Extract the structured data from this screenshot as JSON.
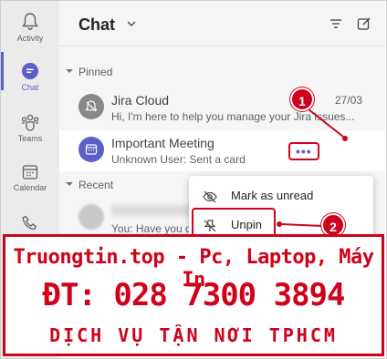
{
  "rail": {
    "items": [
      {
        "label": "Activity",
        "icon": "bell-icon"
      },
      {
        "label": "Chat",
        "icon": "chat-icon"
      },
      {
        "label": "Teams",
        "icon": "teams-icon"
      },
      {
        "label": "Calendar",
        "icon": "calendar-icon"
      },
      {
        "label": "Calls",
        "icon": "phone-icon"
      }
    ],
    "active_color": "#5b5fc7"
  },
  "header": {
    "title": "Chat"
  },
  "sections": {
    "pinned": "Pinned",
    "recent": "Recent"
  },
  "chats": [
    {
      "name": "Jira Cloud",
      "preview": "Hi, I'm here to help you manage your Jira issues...",
      "time": "27/03"
    },
    {
      "name": "Important Meeting",
      "preview": "Unknown User: Sent a card",
      "time": ""
    },
    {
      "name": "",
      "preview": "You: Have you d",
      "time": ""
    }
  ],
  "more_button": {
    "label": "•••"
  },
  "menu": {
    "items": [
      {
        "label": "Mark as unread",
        "icon": "mark-unread-icon"
      },
      {
        "label": "Unpin",
        "icon": "unpin-icon"
      }
    ]
  },
  "callouts": [
    "1",
    "2"
  ],
  "banner": {
    "line1": "Truongtin.top - Pc, Laptop, Máy In",
    "line2": "ĐT: 028 7300 3894",
    "line3": "DỊCH VỤ TẬN NƠI TPHCM"
  },
  "colors": {
    "accent": "#5b5fc7",
    "annotation": "#d0021b"
  }
}
